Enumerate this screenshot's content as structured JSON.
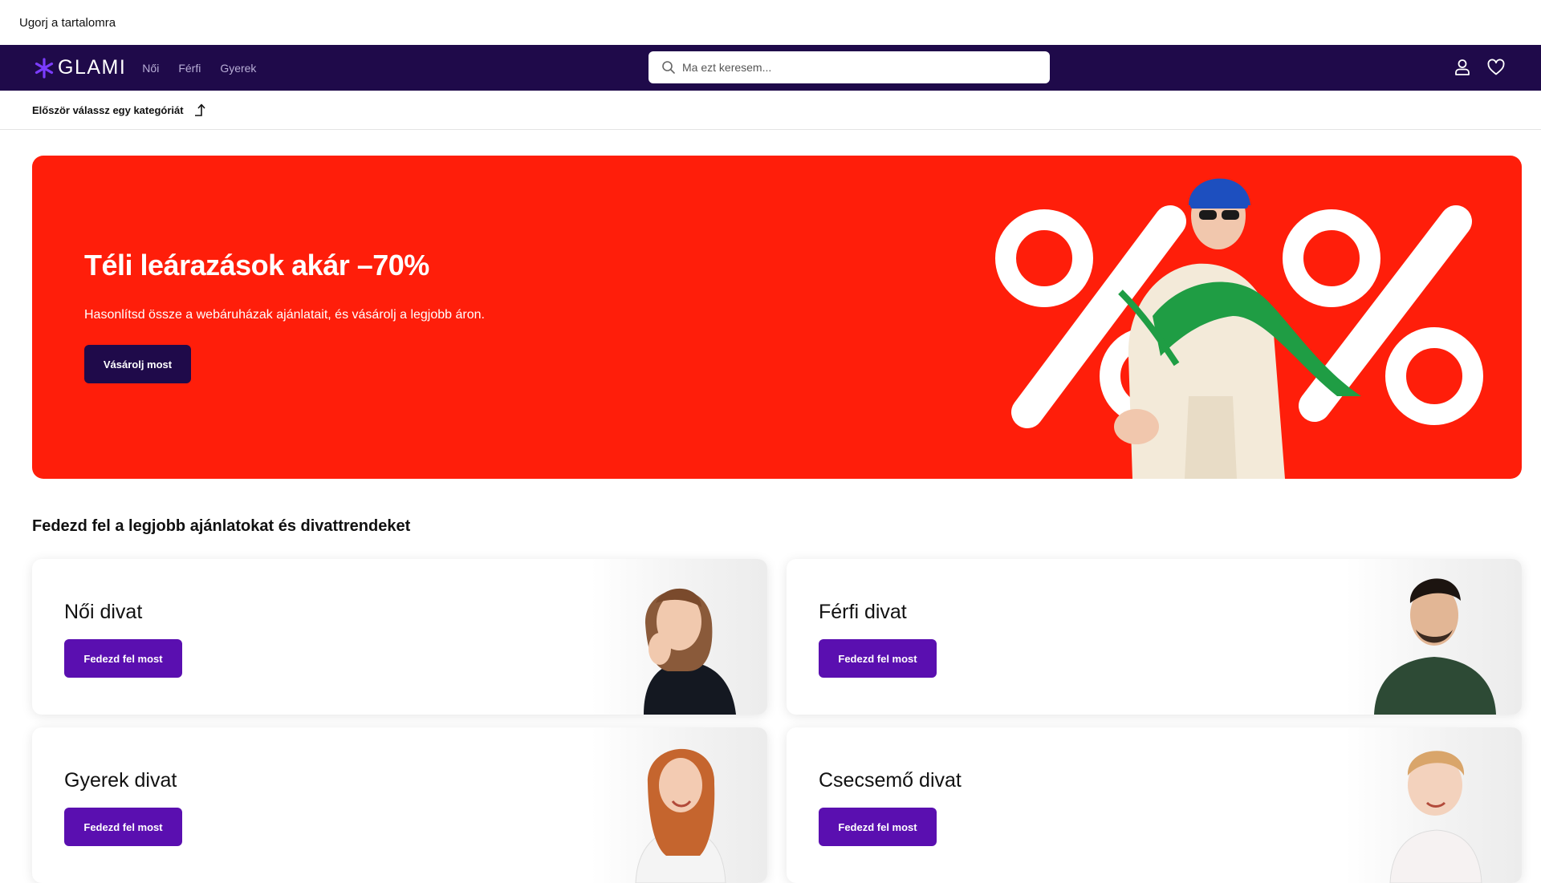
{
  "skip_link": "Ugorj a tartalomra",
  "nav": {
    "logo_text": "GLAMI",
    "links": [
      "Női",
      "Férfi",
      "Gyerek"
    ],
    "search_placeholder": "Ma ezt keresem...",
    "icons": [
      "user-icon",
      "heart-icon"
    ],
    "bg_color": "#1f0a4a"
  },
  "category_hint": "Először válassz egy kategóriát",
  "hero": {
    "title": "Téli leárazások akár –70%",
    "subtitle": "Hasonlítsd össze a webáruházak ajánlatait, és vásárolj a legjobb áron.",
    "cta": "Vásárolj most",
    "bg_color": "#ff1e0a"
  },
  "section_title": "Fedezd fel a legjobb ajánlatokat és divattrendeket",
  "cards": [
    {
      "title": "Női divat",
      "button": "Fedezd fel most"
    },
    {
      "title": "Férfi divat",
      "button": "Fedezd fel most"
    },
    {
      "title": "Gyerek divat",
      "button": "Fedezd fel most"
    },
    {
      "title": "Csecsemő divat",
      "button": "Fedezd fel most"
    }
  ],
  "accent_color": "#5a0fb0"
}
